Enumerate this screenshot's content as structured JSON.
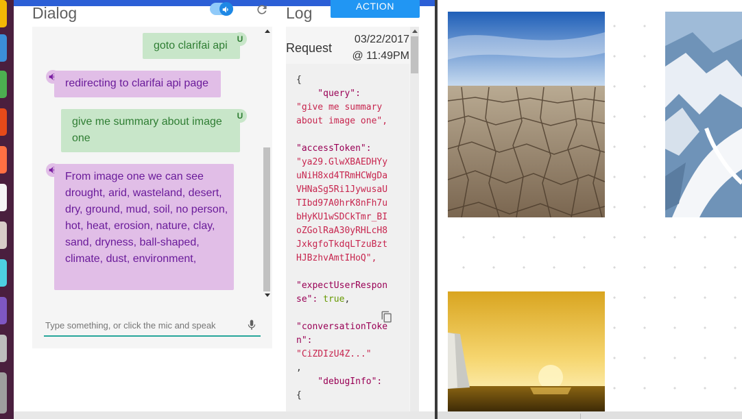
{
  "dialog": {
    "title": "Dialog",
    "messages": [
      {
        "role": "user",
        "text": "goto clarifai api",
        "badge": "U"
      },
      {
        "role": "agent",
        "text": "redirecting to clarifai api page"
      },
      {
        "role": "user",
        "text": "give me summary about image one",
        "badge": "U"
      },
      {
        "role": "agent",
        "text": "From image one we can see drought, arid, wasteland, desert, dry, ground, mud, soil, no person, hot, heat, erosion, nature, clay, sand, dryness, ball-shaped, climate, dust, environment,"
      }
    ],
    "input_placeholder": "Type something, or click the mic and speak"
  },
  "log": {
    "title": "Log",
    "action_button": "ACTION PACKAGE",
    "request_label": "Request",
    "request_date": "03/22/2017",
    "request_time": "@ 11:49PM",
    "json_lines": [
      {
        "k": "{",
        "c": "punc"
      },
      {
        "k": "    \"query\":",
        "c": "key"
      },
      {
        "k": "\"give me summary",
        "c": "str"
      },
      {
        "k": "about image one\",",
        "c": "str"
      },
      {
        "k": "",
        "c": "punc"
      },
      {
        "k": "\"accessToken\":",
        "c": "key"
      },
      {
        "k": "\"ya29.GlwXBAEDHYy",
        "c": "str"
      },
      {
        "k": "uNiH8xd4TRmHCWgDa",
        "c": "str"
      },
      {
        "k": "VHNaSg5Ri1JywusaU",
        "c": "str"
      },
      {
        "k": "TIbd97A0hrK8nFh7u",
        "c": "str"
      },
      {
        "k": "bHyKU1wSDCkTmr_BI",
        "c": "str"
      },
      {
        "k": "oZGolRaA30yRHLcH8",
        "c": "str"
      },
      {
        "k": "JxkgfoTkdqLTzuBzt",
        "c": "str"
      },
      {
        "k": "HJBzhvAmtIHoQ\",",
        "c": "str"
      },
      {
        "k": "",
        "c": "punc"
      },
      {
        "k": "\"expectUserRespon",
        "c": "key"
      },
      {
        "k": "se\": true,",
        "c": "mixed_bool"
      },
      {
        "k": "",
        "c": "punc"
      },
      {
        "k": "\"conversationToke",
        "c": "key"
      },
      {
        "k": "n\":",
        "c": "key"
      },
      {
        "k": "\"CiZDIzU4Z...\"",
        "c": "str"
      },
      {
        "k": ",",
        "c": "punc"
      },
      {
        "k": "    \"debugInfo\":",
        "c": "key"
      },
      {
        "k": "{",
        "c": "punc"
      }
    ]
  },
  "screen": {
    "images": [
      {
        "name": "cracked-earth-image",
        "desc": "drought"
      },
      {
        "name": "glacier-aerial-image",
        "desc": "glacier"
      },
      {
        "name": "sunset-sea-cliff-image",
        "desc": "sunset"
      }
    ]
  },
  "colors": {
    "user_bubble": "#c8e6c9",
    "user_text": "#2e7d32",
    "agent_bubble": "#e1bee7",
    "agent_text": "#6a1b9a",
    "accent": "#2196f3",
    "input_underline": "#26a69a"
  }
}
